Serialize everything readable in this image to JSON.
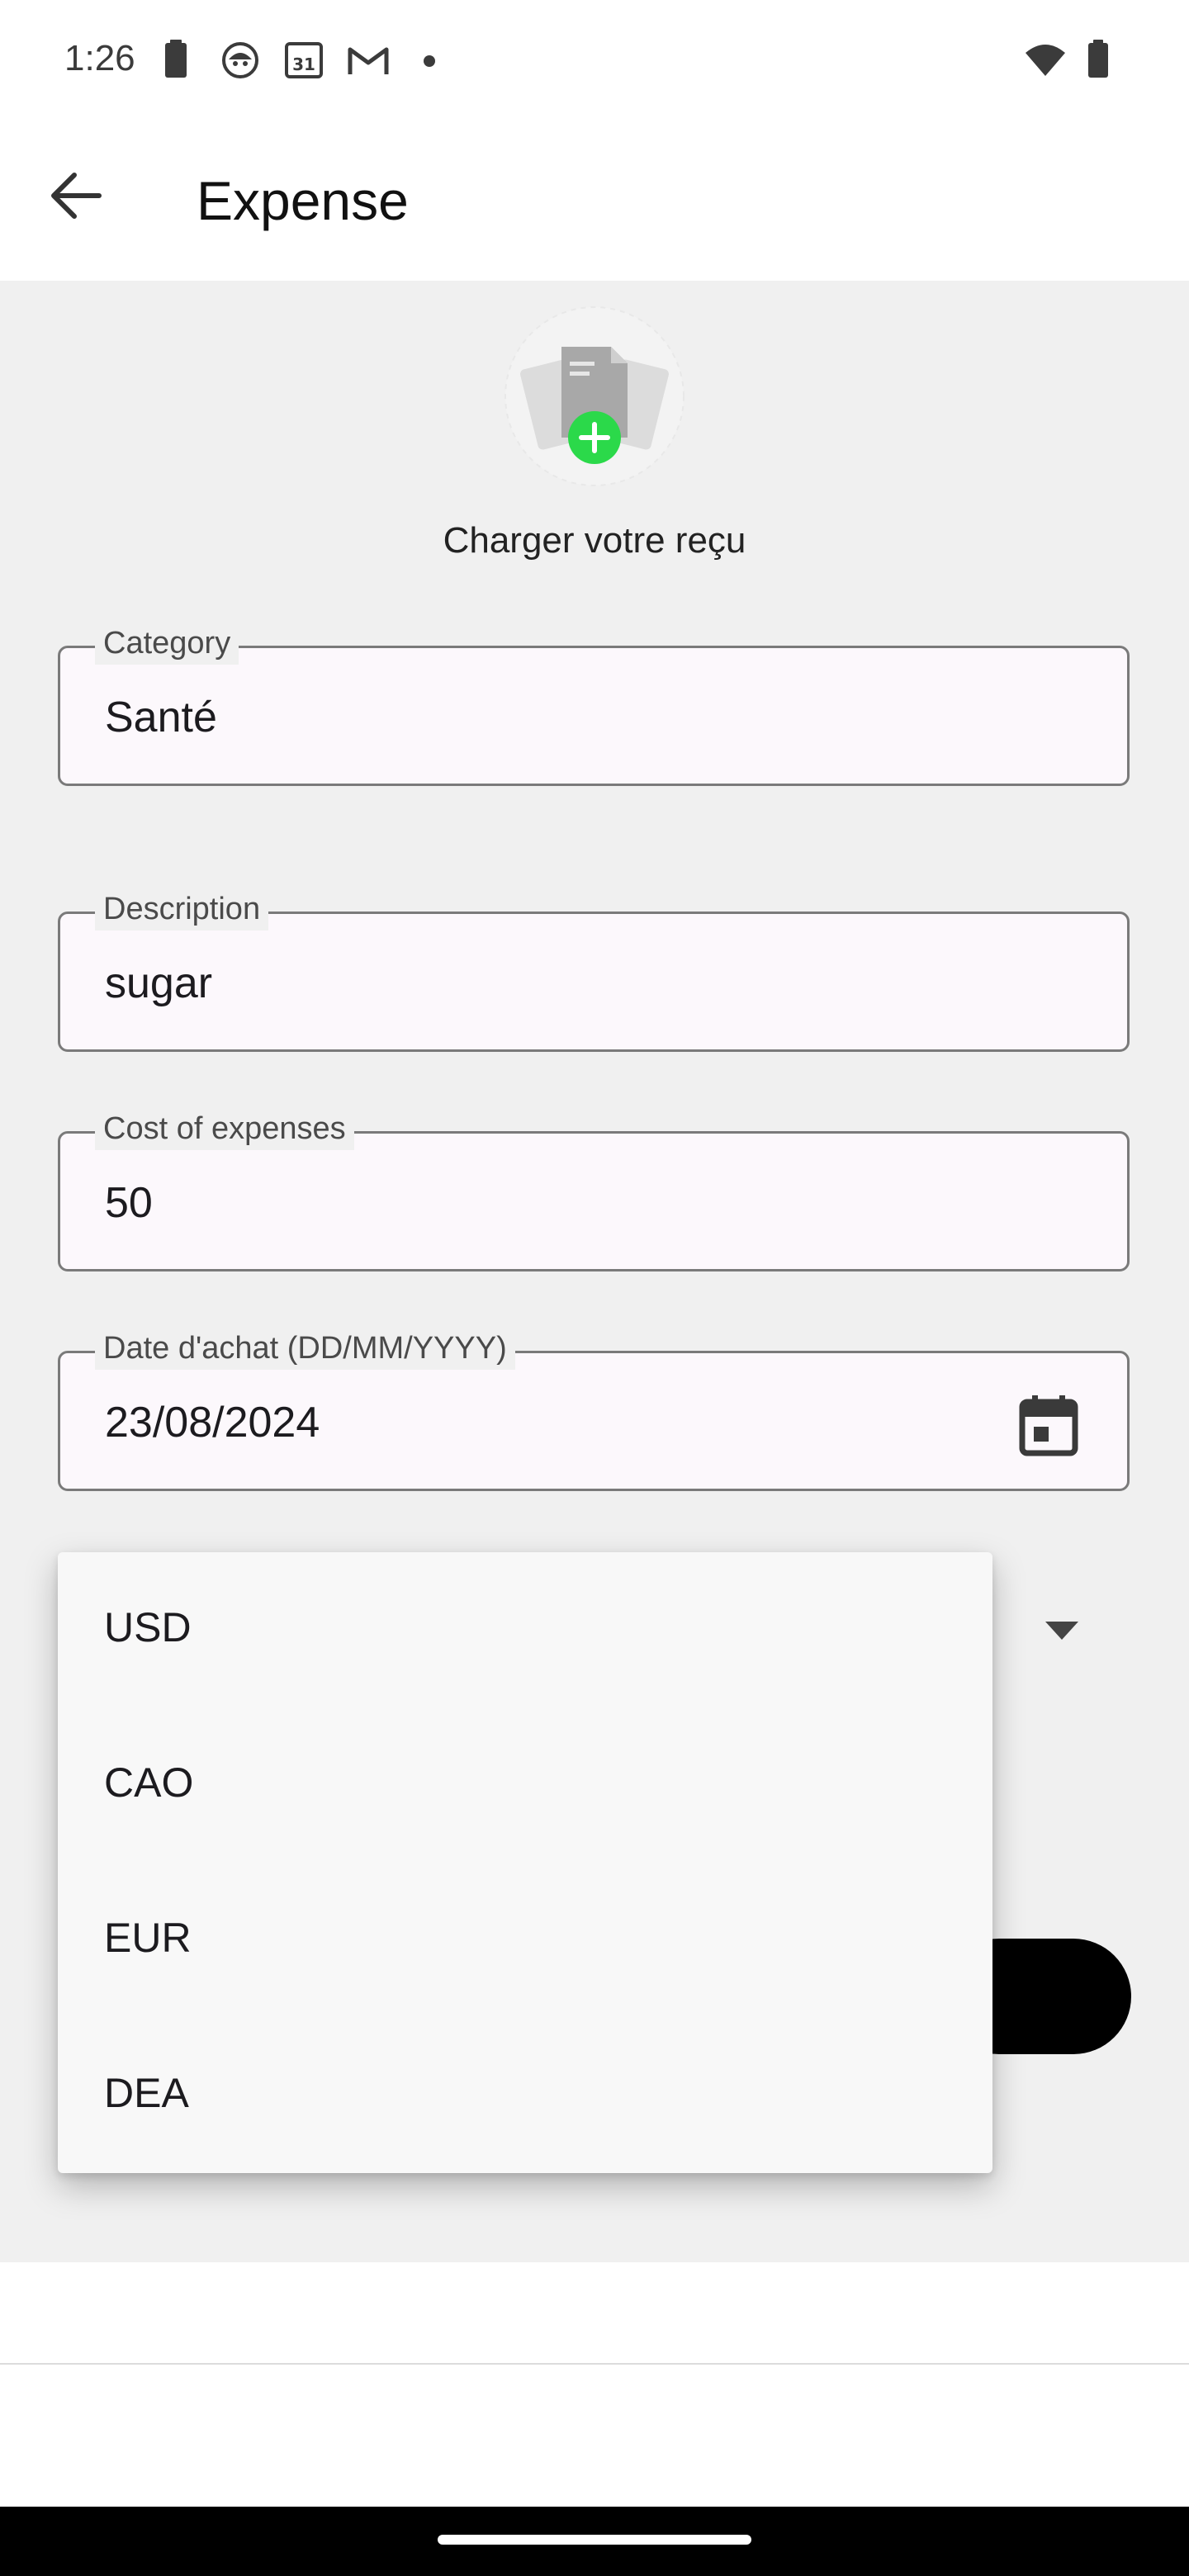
{
  "status_bar": {
    "time": "1:26",
    "icons": [
      "battery-saver-icon",
      "app-avatar-icon",
      "calendar-31-icon",
      "gmail-icon",
      "dot-icon",
      "wifi-icon",
      "battery-icon"
    ],
    "calendar_day": "31"
  },
  "app_bar": {
    "back_icon": "arrow-back-icon",
    "title": "Expense"
  },
  "receipt": {
    "icon": "document-add-icon",
    "upload_label": "Charger votre reçu",
    "accent_color": "#2bd94a"
  },
  "form": {
    "category": {
      "label": "Category",
      "value": "Santé"
    },
    "description": {
      "label": "Description",
      "value": "sugar"
    },
    "cost": {
      "label": "Cost of expenses",
      "value": "50"
    },
    "date": {
      "label": "Date d'achat (DD/MM/YYYY)",
      "value": "23/08/2024",
      "icon": "calendar-icon"
    },
    "currency": {
      "arrow_icon": "dropdown-arrow-icon"
    }
  },
  "currency_menu": {
    "options": [
      "USD",
      "CAO",
      "EUR",
      "DEA"
    ]
  },
  "colors": {
    "content_bg": "#f0f0f0",
    "field_bg": "#fcf8fc",
    "field_border": "#7a7a7a",
    "button": "#000000"
  }
}
